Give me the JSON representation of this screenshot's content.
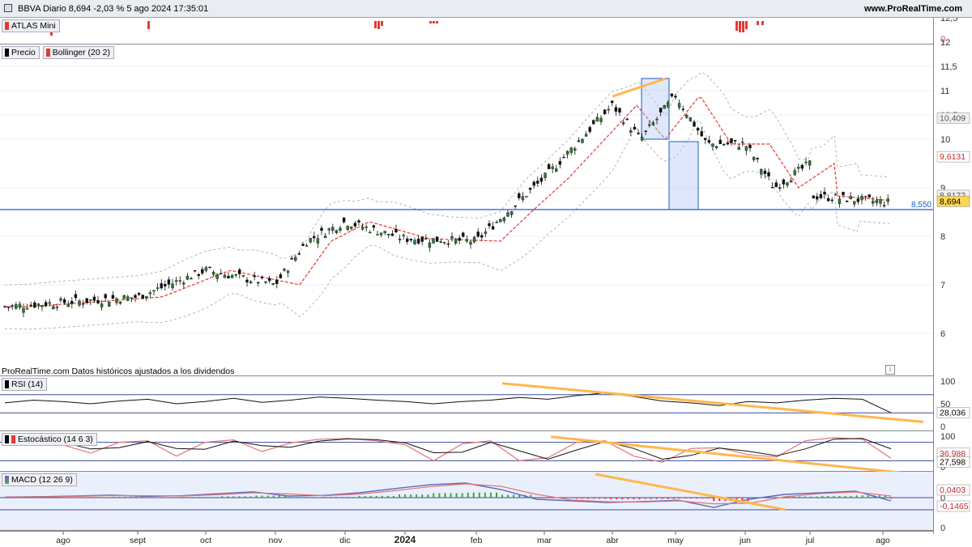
{
  "header": {
    "title": "BBVA Diario 8,694 -2,03 % 5 ago 2024 17:35:01",
    "site": "www.ProRealTime.com"
  },
  "legends": {
    "atlas": "ATLAS Mini",
    "precio": "Precio",
    "bollinger": "Bollinger (20 2)",
    "rsi": "RSI (14)",
    "stoch": "Estocástico (14 6 3)",
    "macd": "MACD (12 26 9)"
  },
  "note": "ProRealTime.com  Datos históricos ajustados a los dividendos",
  "colors": {
    "up": "#2e7d32",
    "down": "#000000",
    "bbMid": "#e53935",
    "bbBand": "#b0b6bd",
    "trend": "#ffb74d",
    "support": "#1e5bc6",
    "highlight": "#b7c9f5"
  },
  "chart_data": [
    {
      "type": "candlestick",
      "title": "BBVA Diario",
      "x_labels": [
        "ago",
        "sept",
        "oct",
        "nov",
        "dic",
        "2024",
        "feb",
        "mar",
        "abr",
        "may",
        "jun",
        "jul",
        "ago"
      ],
      "y_ticks": [
        "12,5",
        "12",
        "11,5",
        "11",
        "10,5",
        "10",
        "9",
        "8",
        "7",
        "6"
      ],
      "ylim": [
        6,
        12.75
      ],
      "price_path": [
        [
          "ago",
          6.55
        ],
        [
          "sept",
          6.75
        ],
        [
          "oct",
          7.3
        ],
        [
          "nov",
          7.0
        ],
        [
          "nov",
          7.9
        ],
        [
          "dic",
          8.3
        ],
        [
          "2024",
          7.95
        ],
        [
          "feb",
          7.9
        ],
        [
          "feb",
          8.5
        ],
        [
          "mar",
          9.2
        ],
        [
          "abr",
          10.7
        ],
        [
          "abr",
          10.0
        ],
        [
          "may",
          10.9
        ],
        [
          "may",
          9.9
        ],
        [
          "jun",
          9.9
        ],
        [
          "jun",
          9.0
        ],
        [
          "jul",
          9.5
        ],
        [
          "ago",
          10.1
        ],
        [
          "ago",
          8.694
        ]
      ],
      "bollinger": {
        "upper": 10.409,
        "middle": 9.6131,
        "lower": 8.8172
      },
      "last_price": "8,694",
      "support_level": "8,550",
      "axis_labels": {
        "upper": "10,409",
        "middle": "9,6131",
        "lower": "8,8172",
        "last": "8,694"
      }
    },
    {
      "type": "line",
      "name": "RSI (14)",
      "y_ticks": [
        "100",
        "50",
        "0"
      ],
      "levels": [
        70,
        30
      ],
      "last_value": "28,036",
      "values": [
        52,
        58,
        55,
        50,
        56,
        60,
        50,
        55,
        62,
        53,
        58,
        65,
        62,
        58,
        55,
        50,
        55,
        58,
        64,
        60,
        68,
        74,
        66,
        56,
        52,
        46,
        55,
        52,
        58,
        62,
        60,
        30
      ]
    },
    {
      "type": "line",
      "name": "Estocástico (14 6 3)",
      "y_ticks": [
        "100",
        "0"
      ],
      "levels": [
        80,
        20
      ],
      "last_values": [
        "36,988",
        "27,598"
      ],
      "values": [
        70,
        88,
        72,
        45,
        80,
        85,
        35,
        80,
        88,
        50,
        78,
        90,
        92,
        85,
        72,
        20,
        75,
        85,
        20,
        30,
        80,
        85,
        35,
        15,
        60,
        62,
        40,
        32,
        85,
        95,
        90,
        28
      ]
    },
    {
      "type": "line",
      "name": "MACD (12 26 9)",
      "y_ticks": [
        "0"
      ],
      "last_values": [
        "0,0403",
        "-0,1465"
      ],
      "values": [
        0.02,
        0.03,
        0.05,
        0.08,
        0.04,
        0.06,
        0.12,
        0.18,
        0.05,
        0.07,
        0.15,
        0.28,
        0.4,
        0.45,
        0.25,
        -0.05,
        -0.1,
        -0.15,
        -0.12,
        -0.08,
        -0.3,
        -0.05,
        0.1,
        0.15,
        0.2,
        -0.1
      ]
    }
  ]
}
